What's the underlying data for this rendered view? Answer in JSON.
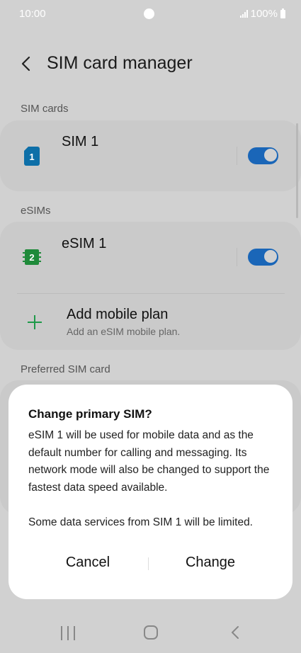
{
  "status": {
    "time": "10:00",
    "battery": "100%"
  },
  "header": {
    "title": "SIM card manager"
  },
  "sections": {
    "sim_cards": "SIM cards",
    "esims": "eSIMs",
    "preferred": "Preferred SIM card"
  },
  "sim1": {
    "label": "SIM 1",
    "badge": "1",
    "enabled": true
  },
  "esim1": {
    "label": "eSIM 1",
    "badge": "2",
    "enabled": true
  },
  "add_plan": {
    "title": "Add mobile plan",
    "subtitle": "Add an eSIM mobile plan."
  },
  "dialog": {
    "title": "Change primary SIM?",
    "body": "eSIM 1 will be used for mobile data and as the default number for calling and messaging. Its network mode will also be changed to support the fastest data speed available.\n\nSome data services from SIM 1 will be limited.",
    "cancel": "Cancel",
    "confirm": "Change"
  },
  "colors": {
    "accent": "#1a66b8",
    "sim_icon": "#0d6fa8",
    "esim_icon": "#1f8a3a",
    "add_icon": "#1f9a4a"
  }
}
